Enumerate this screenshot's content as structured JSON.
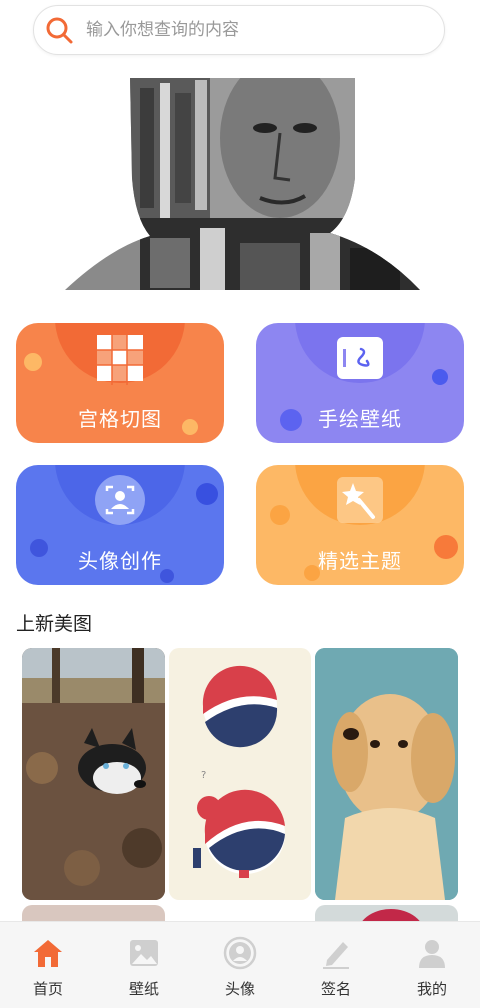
{
  "search": {
    "placeholder": "输入你想查询的内容"
  },
  "categories": [
    {
      "label": "宫格切图",
      "icon": "grid-icon"
    },
    {
      "label": "手绘壁纸",
      "icon": "hand-drawn-icon"
    },
    {
      "label": "头像创作",
      "icon": "portrait-icon"
    },
    {
      "label": "精选主题",
      "icon": "magic-wand-icon"
    }
  ],
  "section": {
    "title": "上新美图"
  },
  "tabs": [
    {
      "label": "首页",
      "icon": "home-icon",
      "active": true
    },
    {
      "label": "壁纸",
      "icon": "image-icon",
      "active": false
    },
    {
      "label": "头像",
      "icon": "avatar-icon",
      "active": false
    },
    {
      "label": "签名",
      "icon": "pen-icon",
      "active": false
    },
    {
      "label": "我的",
      "icon": "user-icon",
      "active": false
    }
  ],
  "colors": {
    "accent": "#f26a36",
    "card_orange": "#f7844b",
    "card_purple": "#8d86f1",
    "card_blue": "#5b76ee",
    "card_yellow": "#fdb865"
  }
}
